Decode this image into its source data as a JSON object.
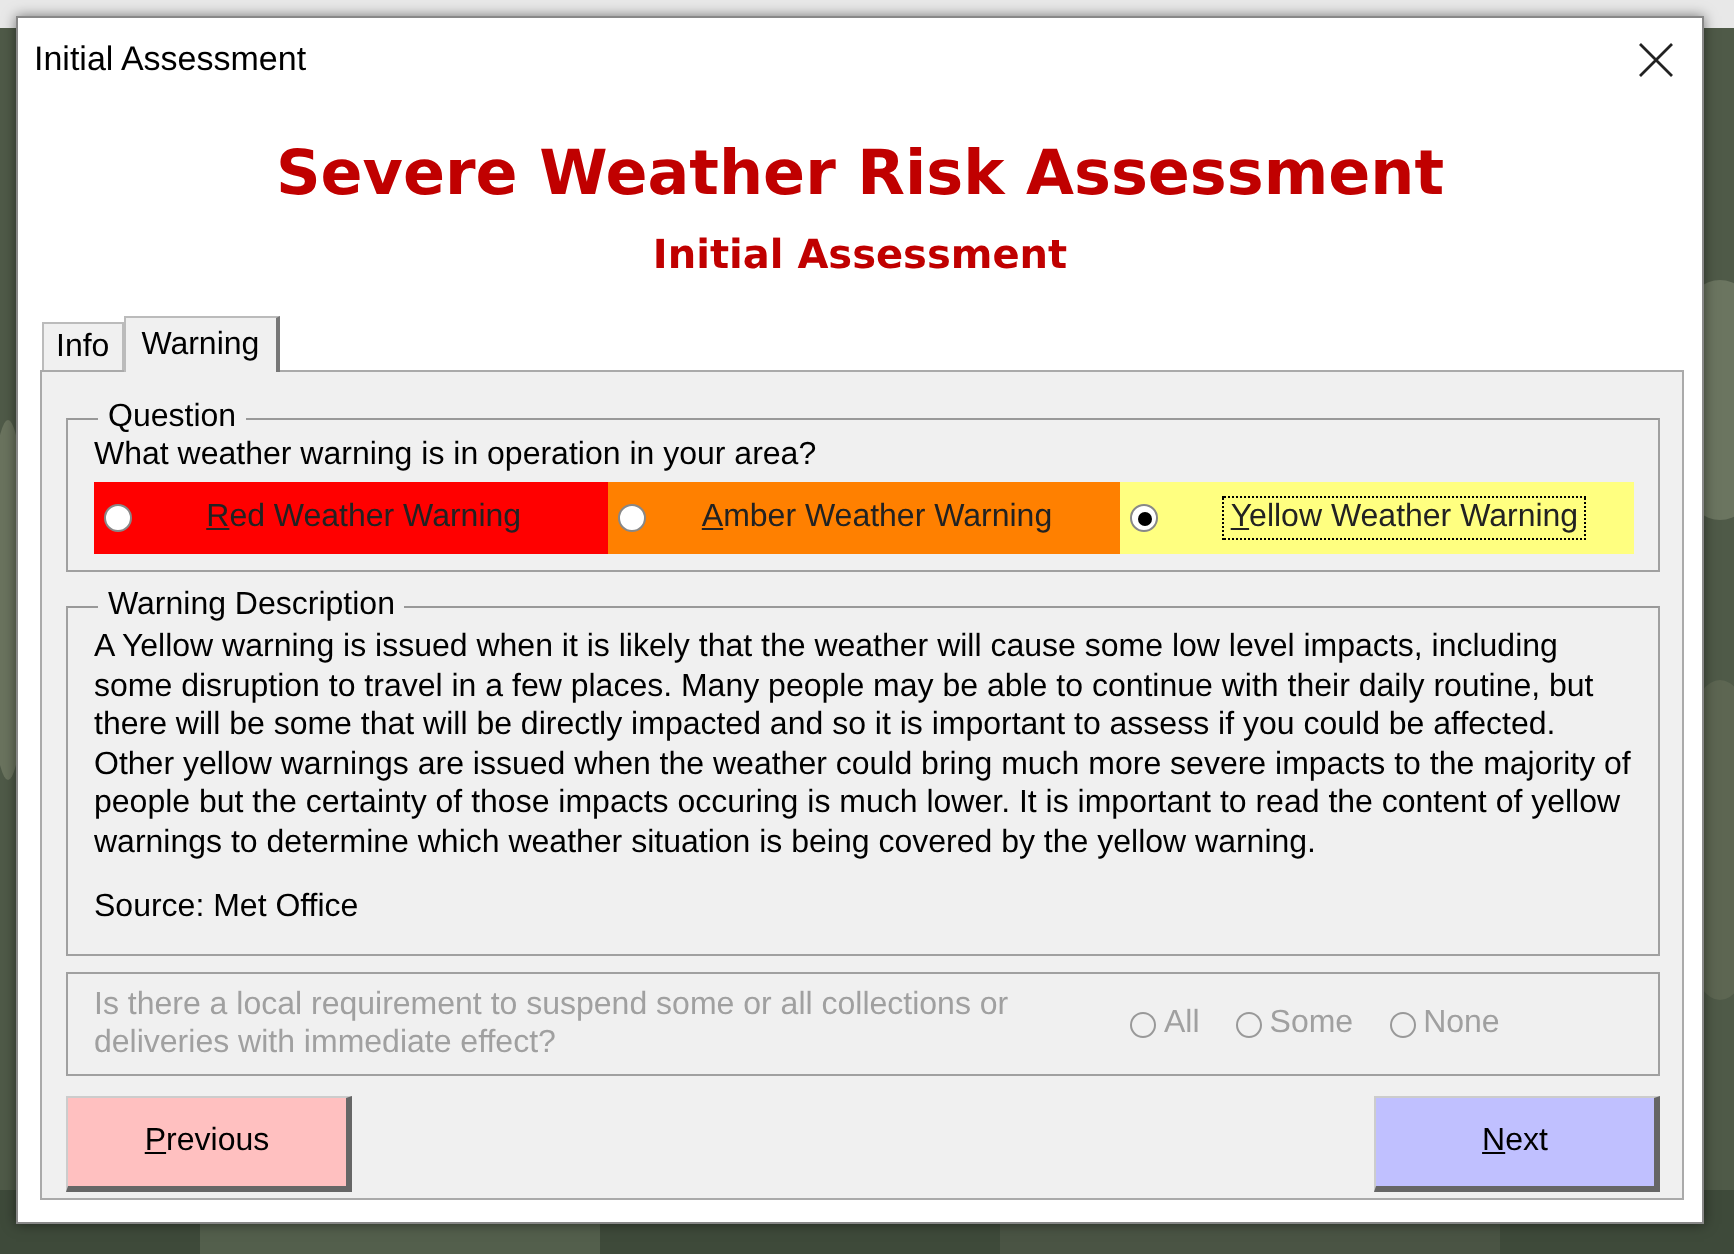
{
  "window": {
    "title": "Initial Assessment"
  },
  "heading": {
    "title": "Severe Weather Risk Assessment",
    "subtitle": "Initial Assessment"
  },
  "tabs": [
    {
      "label": "Info",
      "selected": false
    },
    {
      "label": "Warning",
      "selected": true
    }
  ],
  "question": {
    "legend": "Question",
    "prompt": "What weather warning is in operation  in your area?",
    "options": [
      {
        "label": "Red Weather Warning",
        "underline_first": true,
        "color": "#ff0000",
        "selected": false
      },
      {
        "label": "Amber Weather Warning",
        "underline_first": true,
        "color": "#ff8000",
        "selected": false
      },
      {
        "label": "Yellow Weather Warning",
        "underline_first": true,
        "color": "#ffff80",
        "selected": true
      }
    ]
  },
  "description": {
    "legend": "Warning Description",
    "text": "A Yellow warning is issued when it is likely that the weather will cause some low level impacts, including some disruption to travel in a few places. Many people may be able to continue with their daily routine, but there will be some that will be directly impacted and so it is important to assess if you could be affected. Other yellow warnings are issued when the weather could bring much more severe impacts to the majority of people but the certainty of those impacts occuring is much lower. It is important to read the content of yellow warnings to determine which weather situation is being covered by the yellow warning.",
    "source": "Source: Met Office"
  },
  "suspension": {
    "prompt": "Is there a local  requirement to suspend some or all collections or deliveries with immediate effect?",
    "disabled": true,
    "options": [
      {
        "label": "All",
        "selected": false
      },
      {
        "label": "Some",
        "selected": false
      },
      {
        "label": "None",
        "selected": false
      }
    ]
  },
  "buttons": [
    {
      "label": "Previous",
      "underline_first": true,
      "color": "#ffc0c0"
    },
    {
      "label": "Next",
      "underline_first": true,
      "color": "#c0c0ff"
    }
  ]
}
